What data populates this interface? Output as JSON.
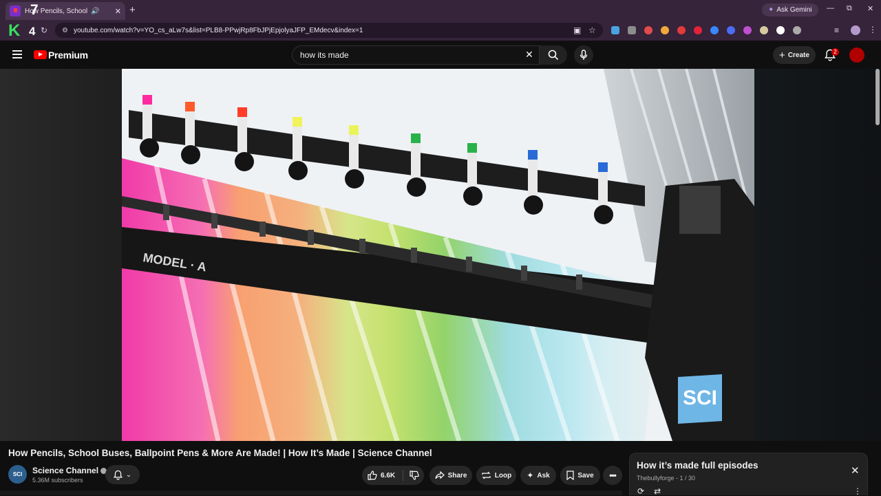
{
  "browser": {
    "tab_title": "How Pencils, School Bus",
    "tab_speaker": "🔊",
    "tab_close": "✕",
    "new_tab": "+",
    "ask_gemini": "Ask Gemini",
    "url": "youtube.com/watch?v=YO_cs_aLw7s&list=PLB8-PPwjRp8FbJPjEpjolyaJFP_EMdecv&index=1",
    "win_min": "—",
    "win_max": "⧉",
    "win_close": "✕",
    "overlay_left_number": "4",
    "overlay_top_number": "7",
    "overlay_k": "K",
    "ext_colors": [
      "#4aa3e0",
      "#8c8c8c",
      "#e24b4b",
      "#f2a93b",
      "#e23b3b",
      "#e2223b",
      "#3a86ff",
      "#4a6cf7",
      "#c04fd0",
      "#d6c9a0",
      "#ffffff",
      "#aaaaaa"
    ]
  },
  "header": {
    "brand": "Premium",
    "search_value": "how its made",
    "create_label": "Create",
    "notif_count": "2"
  },
  "video": {
    "title": "How Pencils, School Buses, Ballpoint Pens & More Are Made! | How It’s Made | Science Channel",
    "channel_name": "Science Channel",
    "channel_avatar_text": "SCI",
    "subscribers": "5.36M subscribers",
    "likes": "6.6K",
    "share_label": "Share",
    "loop_label": "Loop",
    "ask_label": "Ask",
    "save_label": "Save",
    "watermark": "SCI",
    "machine_text": "MODEL · A"
  },
  "playlist": {
    "title": "How it’s made full episodes",
    "meta": "Thebullyforge - 1 / 30"
  }
}
